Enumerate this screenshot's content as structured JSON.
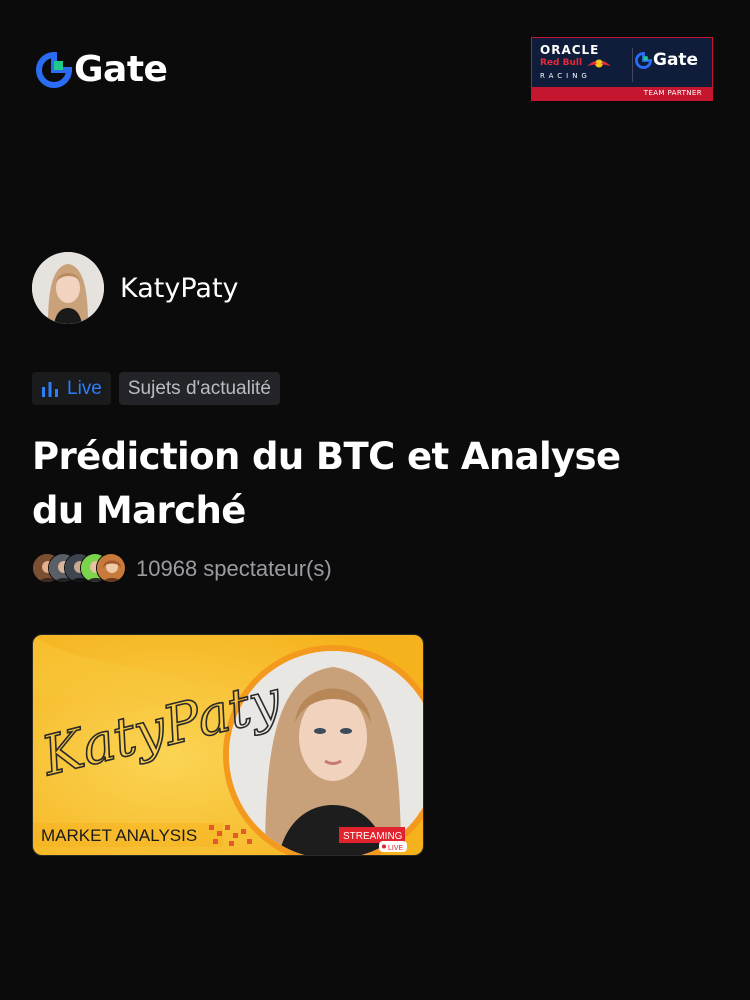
{
  "brand": {
    "name": "Gate",
    "partner_badge": {
      "oracle": "ORACLE",
      "redbull": "Red Bull",
      "racing": "RACING",
      "gate": "Gate",
      "team_partner": "TEAM PARTNER"
    }
  },
  "streamer": {
    "name": "KatyPaty"
  },
  "tags": {
    "live": "Live",
    "topic": "Sujets d'actualité"
  },
  "stream": {
    "title": "Prédiction du BTC et Analyse du Marché",
    "viewers": "10968 spectateur(s)"
  },
  "thumbnail": {
    "script": "KatyPaty",
    "market_analysis": "MARKET ANALYSIS",
    "streaming": "STREAMING",
    "live": "LIVE"
  },
  "colors": {
    "background": "#0b0b0c",
    "accent_blue": "#2e7ef5",
    "gate_green": "#1ec98b",
    "thumbnail_yellow": "#f9c02e",
    "badge_red": "#c4172f"
  },
  "icons": [
    "gate-logo-icon",
    "bar-chart-icon"
  ]
}
